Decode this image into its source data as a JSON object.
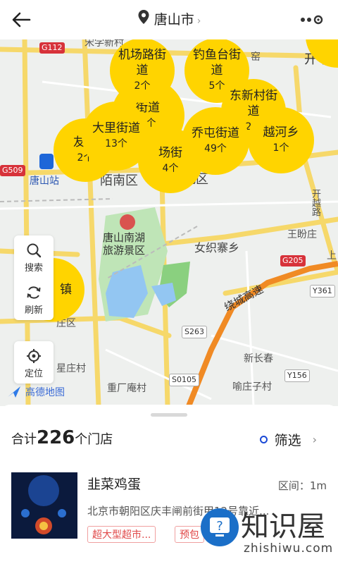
{
  "header": {
    "city": "唐山市",
    "city_chevron": "›"
  },
  "map": {
    "place_labels": [
      "宋学新村",
      "开平",
      "唐山站",
      "路北区",
      "女织寨乡",
      "王盼庄",
      "唐山南湖旅游景区",
      "绕城高速",
      "开越路",
      "新长春",
      "重厂庵村",
      "喻庄子村",
      "星庄村",
      "庄区",
      "窑",
      "陌南区",
      "上"
    ],
    "road_tags": [
      "G112",
      "G509",
      "G205",
      "Y361",
      "S263",
      "Y156",
      "S0105"
    ],
    "clusters": [
      {
        "name": "机场路街道",
        "count": "2个"
      },
      {
        "name": "钓鱼台街道",
        "count": "5个"
      },
      {
        "name": "东新村街道",
        "count": "2个"
      },
      {
        "name": "乔屯街道",
        "count": "49个"
      },
      {
        "name": "越河乡",
        "count": "1个"
      },
      {
        "name": "大里街道",
        "count": "13个"
      },
      {
        "name": "友谊",
        "count": "2个"
      },
      {
        "name": "街道",
        "count": "2个"
      },
      {
        "name": "场街",
        "count": "4个"
      },
      {
        "name": "镇",
        "count": ""
      }
    ],
    "tools": {
      "search": "搜索",
      "refresh": "刷新",
      "locate": "定位"
    },
    "logo": "高德地图"
  },
  "sheet": {
    "total_prefix": "合计",
    "total_count": "226",
    "total_suffix": "个门店",
    "filter_label": "筛选",
    "filter_chevron": "›"
  },
  "store": {
    "name": "韭菜鸡蛋",
    "distance": "区间：1m",
    "address": "北京市朝阳区庆丰闸前街甲12号靠近...",
    "tags": [
      "超大型超市...",
      "预包"
    ]
  },
  "watermark": {
    "text": "知识屋",
    "sub": "zhishiwu.com"
  },
  "colors": {
    "bubble": "#ffd400",
    "accent": "#1a49d6",
    "tag_red": "#e04848"
  }
}
